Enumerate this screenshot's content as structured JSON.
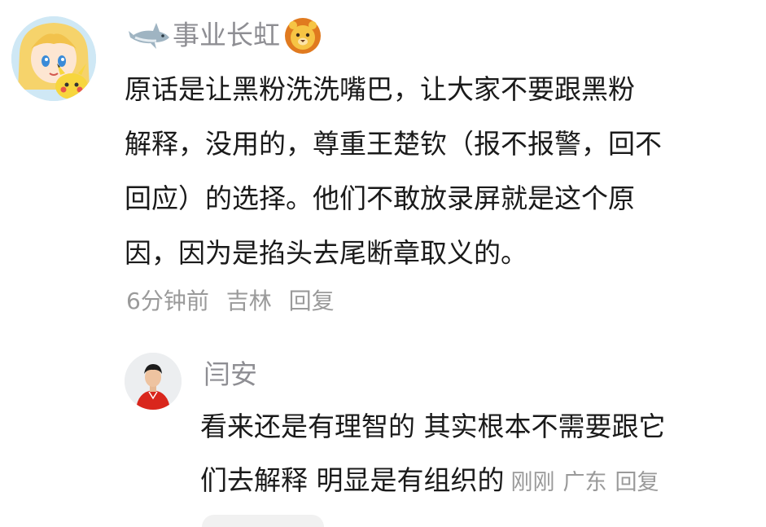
{
  "comment": {
    "username": "事业长虹",
    "lines": [
      "原话是让黑粉洗洗嘴巴，让大家不要跟黑粉",
      "解释，没用的，尊重王楚钦（报不报警，回不",
      "回应）的选择。他们不敢放录屏就是这个原",
      "因，因为是掐头去尾断章取义的。"
    ],
    "time": "6分钟前",
    "location": "吉林",
    "reply_label": "回复"
  },
  "reply": {
    "username": "闫安",
    "lines": [
      "看来还是有理智的 其实根本不需要跟它",
      "们去解释 明显是有组织的"
    ],
    "time": "刚刚",
    "location": "广东",
    "reply_label": "回复"
  },
  "colors": {
    "text": "#1a1a1a",
    "meta": "#9a9a9a",
    "username": "#8e8e93"
  }
}
